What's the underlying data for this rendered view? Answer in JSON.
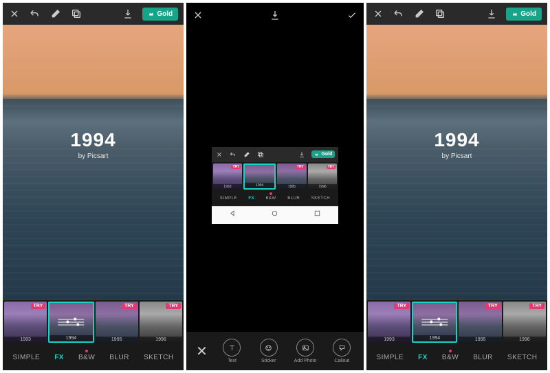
{
  "gold_label": "Gold",
  "overlay": {
    "year": "1994",
    "by": "by Picsart"
  },
  "thumbs": [
    {
      "label": "1993",
      "try": true,
      "variant": "purple"
    },
    {
      "label": "1994",
      "try": false,
      "variant": "active"
    },
    {
      "label": "1995",
      "try": true,
      "variant": "default"
    },
    {
      "label": "1996",
      "try": true,
      "variant": "gray"
    }
  ],
  "thumb_try_label": "TRY",
  "tabs": [
    {
      "label": "SIMPLE",
      "active": false,
      "dot": false
    },
    {
      "label": "FX",
      "active": true,
      "dot": false
    },
    {
      "label": "B&W",
      "active": false,
      "dot": true
    },
    {
      "label": "BLUR",
      "active": false,
      "dot": false
    },
    {
      "label": "SKETCH",
      "active": false,
      "dot": false
    }
  ],
  "bottom_tools": [
    {
      "label": "Text",
      "icon": "text"
    },
    {
      "label": "Sticker",
      "icon": "sticker"
    },
    {
      "label": "Add Photo",
      "icon": "photo"
    },
    {
      "label": "Callout",
      "icon": "callout"
    }
  ]
}
